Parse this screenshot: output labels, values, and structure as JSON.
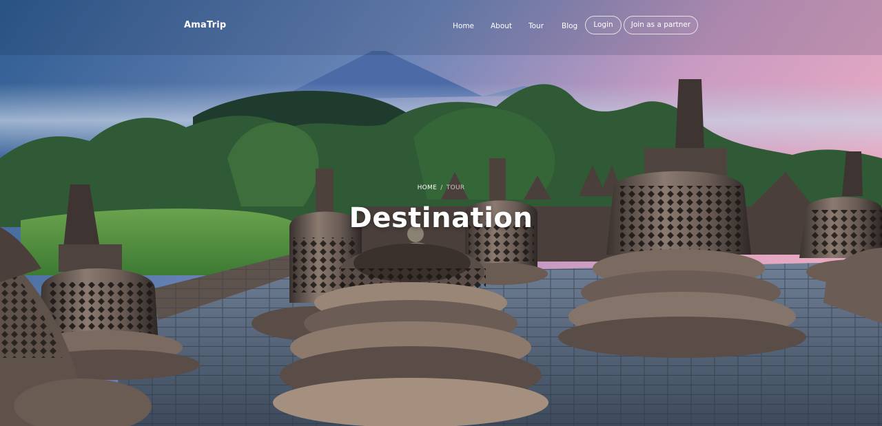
{
  "header": {
    "logo": "AmaTrip",
    "nav": {
      "home": "Home",
      "about": "About",
      "tour": "Tour",
      "blog": "Blog"
    },
    "login_label": "Login",
    "partner_label": "Join as a partner"
  },
  "hero": {
    "breadcrumb": {
      "home": "HOME",
      "separator": "/",
      "current": "TOUR"
    },
    "title": "Destination"
  },
  "colors": {
    "text": "#ffffff",
    "sky_top": "#2c5a8c",
    "sky_pink": "#d99fbf",
    "stone": "#6b5e57",
    "foliage": "#3f7a3a"
  }
}
